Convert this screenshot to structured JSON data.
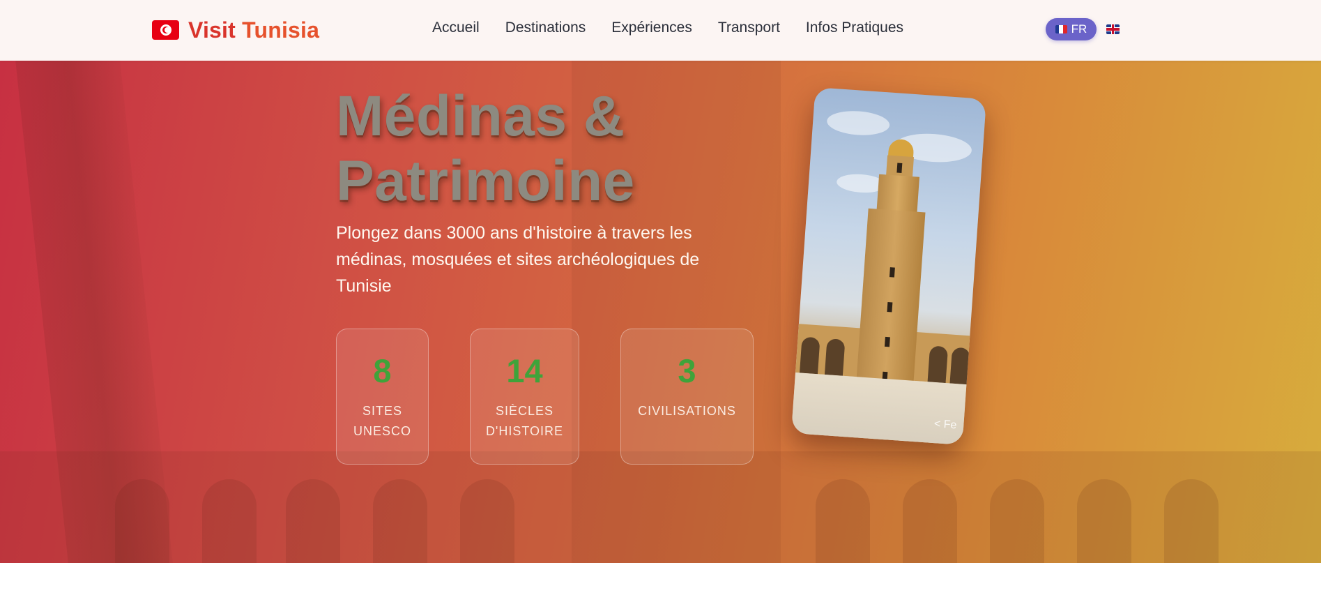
{
  "header": {
    "brand": {
      "name_prefix": "Visit ",
      "name_suffix": "Tunisia",
      "flag_icon": "tunisia-flag-icon"
    },
    "nav": [
      {
        "label": "Accueil"
      },
      {
        "label": "Destinations"
      },
      {
        "label": "Expériences"
      },
      {
        "label": "Transport"
      },
      {
        "label": "Infos Pratiques"
      }
    ],
    "language": {
      "active_label": "FR",
      "active_icon": "france-flag-icon",
      "alternate_icon": "uk-flag-icon"
    }
  },
  "hero": {
    "title_line1": "Médinas &",
    "title_line2": "Patrimoine",
    "subtitle": "Plongez dans 3000 ans d'histoire à travers les médinas, mosquées et sites archéologiques de Tunisie",
    "stats": [
      {
        "value": "8",
        "label": "SITES UNESCO"
      },
      {
        "value": "14",
        "label": "SIÈCLES D'HISTOIRE"
      },
      {
        "value": "3",
        "label": "CIVILISATIONS"
      }
    ],
    "photo": {
      "subject": "minaret-photo",
      "credit_fragment": "< Fe"
    }
  },
  "colors": {
    "brand_red": "#d9342b",
    "hero_gradient_start": "#c73042",
    "hero_gradient_end": "#d7ad3d",
    "stat_number_green": "#3fa33a",
    "lang_pill": "#6b63c9"
  }
}
